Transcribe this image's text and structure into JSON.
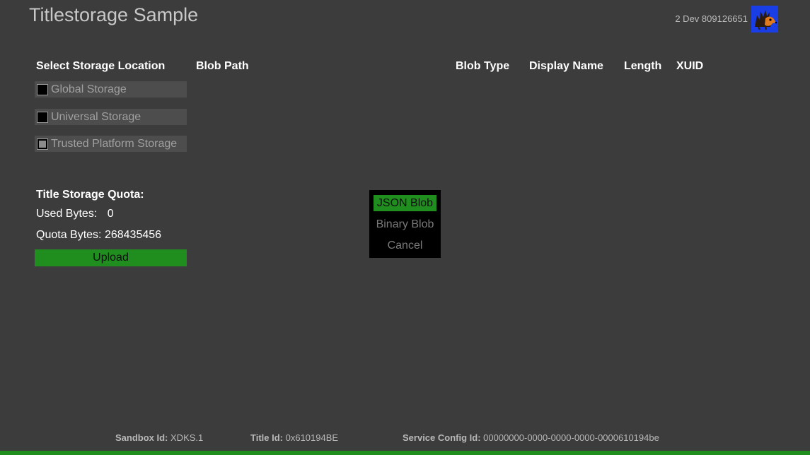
{
  "app": {
    "title": "Titlestorage Sample"
  },
  "user": {
    "gamertag": "2 Dev 809126651",
    "avatar_icon": "hedgehog-avatar-icon",
    "avatar_bg": "#1a3ee6"
  },
  "headers": {
    "select_storage": "Select Storage Location",
    "blob_path": "Blob Path",
    "blob_type": "Blob Type",
    "display_name": "Display Name",
    "length": "Length",
    "xuid": "XUID"
  },
  "storage_options": [
    {
      "label": "Global Storage",
      "enabled": true
    },
    {
      "label": "Universal Storage",
      "enabled": true
    },
    {
      "label": "Trusted Platform Storage",
      "enabled": false
    }
  ],
  "quota": {
    "title": "Title Storage Quota:",
    "used_label": "Used Bytes:",
    "used_value": "0",
    "quota_label": "Quota Bytes:",
    "quota_value": "268435456"
  },
  "upload_label": "Upload",
  "popup_menu": {
    "items": [
      "JSON Blob",
      "Binary Blob",
      "Cancel"
    ],
    "selected_index": 0
  },
  "footer": {
    "sandbox_label": "Sandbox Id:",
    "sandbox_value": "XDKS.1",
    "title_label": "Title Id:",
    "title_value": "0x610194BE",
    "scid_label": "Service Config Id:",
    "scid_value": "00000000-0000-0000-0000-0000610194be"
  },
  "colors": {
    "accent": "#1f8e1f",
    "background": "#3c3c3c"
  }
}
